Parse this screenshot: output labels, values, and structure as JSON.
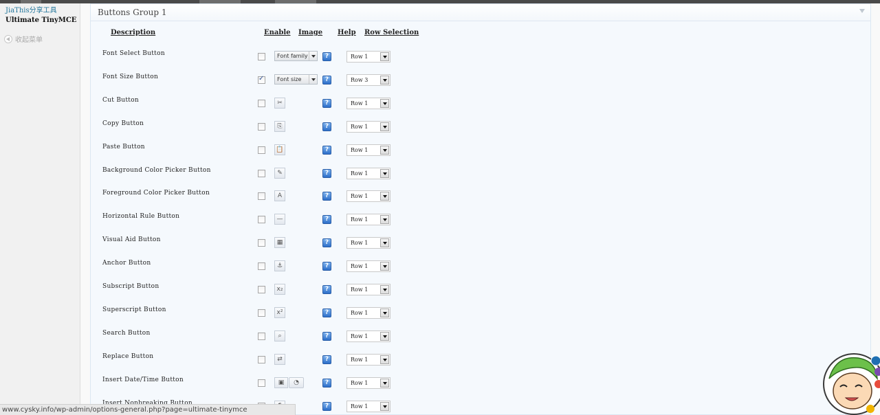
{
  "sidebar": {
    "items": [
      {
        "label": "JiaThis分享工具"
      },
      {
        "label": "Ultimate TinyMCE"
      }
    ],
    "collapse_label": "收起菜单"
  },
  "panel": {
    "title": "Buttons Group 1"
  },
  "table": {
    "headers": {
      "description": "Description",
      "enable": "Enable",
      "image": "Image",
      "help": "Help",
      "row_selection": "Row Selection"
    },
    "rows": [
      {
        "description": "Font Select Button",
        "enabled": false,
        "image": "font-family-select",
        "image_label": "Font family",
        "row": "Row 1"
      },
      {
        "description": "Font Size Button",
        "enabled": true,
        "image": "font-size-select",
        "image_label": "Font size",
        "row": "Row 3"
      },
      {
        "description": "Cut Button",
        "enabled": false,
        "image": "cut-icon",
        "row": "Row 1"
      },
      {
        "description": "Copy Button",
        "enabled": false,
        "image": "copy-icon",
        "row": "Row 1"
      },
      {
        "description": "Paste Button",
        "enabled": false,
        "image": "paste-icon",
        "row": "Row 1"
      },
      {
        "description": "Background Color Picker Button",
        "enabled": false,
        "image": "background-color-icon",
        "row": "Row 1"
      },
      {
        "description": "Foreground Color Picker Button",
        "enabled": false,
        "image": "foreground-color-icon",
        "row": "Row 1"
      },
      {
        "description": "Horizontal Rule Button",
        "enabled": false,
        "image": "horizontal-rule-icon",
        "row": "Row 1"
      },
      {
        "description": "Visual Aid Button",
        "enabled": false,
        "image": "visual-aid-icon",
        "row": "Row 1"
      },
      {
        "description": "Anchor Button",
        "enabled": false,
        "image": "anchor-icon",
        "row": "Row 1"
      },
      {
        "description": "Subscript Button",
        "enabled": false,
        "image": "subscript-icon",
        "row": "Row 1"
      },
      {
        "description": "Superscript Button",
        "enabled": false,
        "image": "superscript-icon",
        "row": "Row 1"
      },
      {
        "description": "Search Button",
        "enabled": false,
        "image": "search-icon",
        "row": "Row 1"
      },
      {
        "description": "Replace Button",
        "enabled": false,
        "image": "replace-icon",
        "row": "Row 1"
      },
      {
        "description": "Insert Date/Time Button",
        "enabled": false,
        "image": "date-time-icons",
        "row": "Row 1"
      },
      {
        "description": "Insert Nonbreaking Button",
        "enabled": false,
        "image": "nonbreaking-icon",
        "row": "Row 1"
      }
    ]
  },
  "status_bar": {
    "url": "www.cysky.info/wp-admin/options-general.php?page=ultimate-tinymce"
  },
  "colors": {
    "sidebar_link": "#21759b",
    "panel_bg": "#f5f9fd",
    "help_icon": "#2d6fc9"
  }
}
